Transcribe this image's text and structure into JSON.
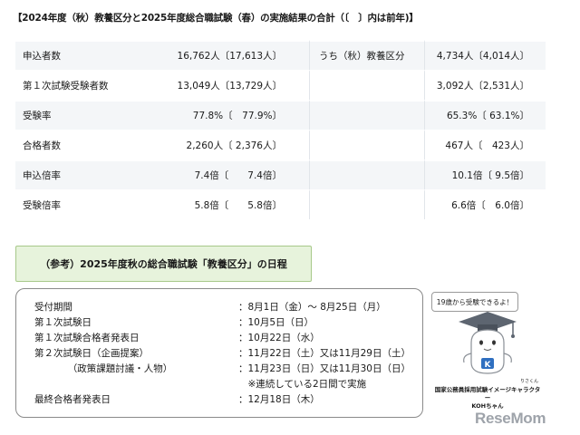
{
  "title": "【2024年度（秋）教養区分と2025年度総合職試験（春）の実施結果の合計（〔　〕内は前年)】",
  "results": {
    "rows": [
      {
        "label": "申込者数",
        "total": "16,762人〔17,613人〕",
        "sub_label": "うち（秋）教養区分",
        "sub": "4,734人〔4,014人〕"
      },
      {
        "label": "第１次試験受験者数",
        "total": "13,049人〔13,729人〕",
        "sub_label": "",
        "sub": "3,092人〔2,531人〕"
      },
      {
        "label": "受験率",
        "total": "77.8%〔　77.9%〕",
        "sub_label": "",
        "sub": "65.3%〔 63.1%〕"
      },
      {
        "label": "合格者数",
        "total": "2,260人〔 2,376人〕",
        "sub_label": "",
        "sub": "467人〔　423人〕"
      },
      {
        "label": "申込倍率",
        "total": "7.4倍〔　　7.4倍〕",
        "sub_label": "",
        "sub": "10.1倍〔 9.5倍〕"
      },
      {
        "label": "受験倍率",
        "total": "5.8倍〔　　5.8倍〕",
        "sub_label": "",
        "sub": "6.6倍〔　6.0倍〕"
      }
    ]
  },
  "schedule": {
    "heading": "（参考）2025年度秋の総合職試験「教養区分」の日程",
    "items": [
      {
        "key": "受付期間",
        "value": "：8月1日（金）～ 8月25日（月）"
      },
      {
        "key": "第１次試験日",
        "value": "：10月5日（日）"
      },
      {
        "key": "第１次試験合格者発表日",
        "value": "：10月22日（水）"
      },
      {
        "key": "第２次試験日（企画提案）",
        "value": "：11月22日（土）又は11月29日（土）"
      },
      {
        "key": "　　　　（政策課題討議・人物）",
        "value": "：11月23日（日）又は11月30日（日）"
      },
      {
        "key": "",
        "value": "　※連続している2日間で実施"
      },
      {
        "key": "最終合格者発表日",
        "value": "：12月18日（木）"
      }
    ]
  },
  "mascot": {
    "speech": "19歳から受験できるよ！",
    "caption_line1": "国家公務員採用試験イメージキャラクター",
    "caption_line2": "KOHちゃん",
    "caption_ruby": "りさくん",
    "badge_letter": "K"
  },
  "logo": "ReseMom"
}
